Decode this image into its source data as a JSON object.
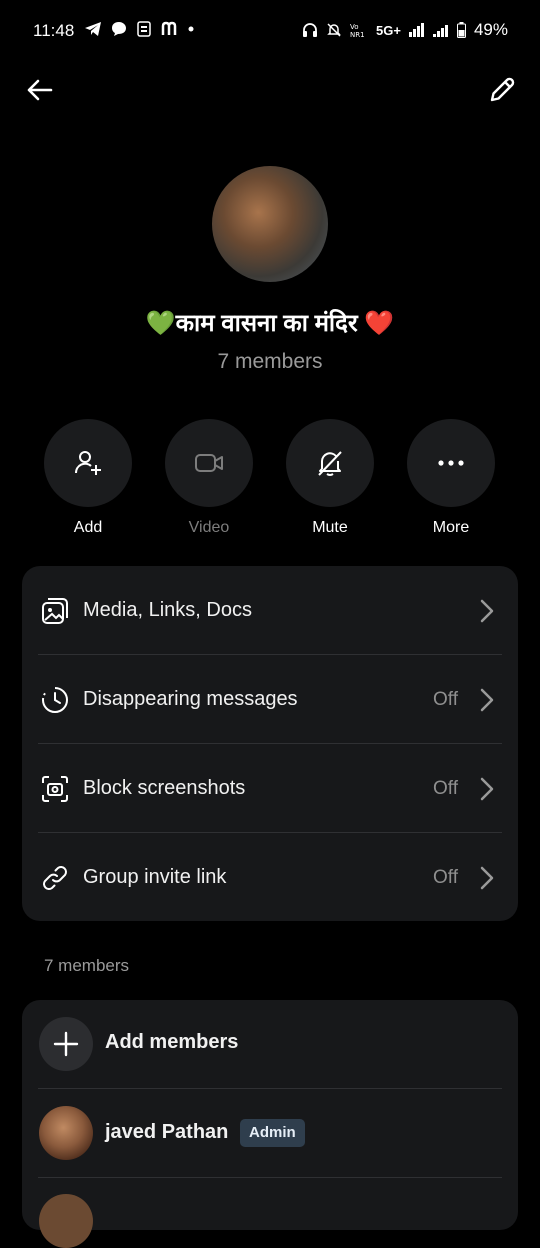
{
  "status_bar": {
    "time": "11:48",
    "network": "5G+",
    "battery": "49%"
  },
  "header": {
    "back_icon": "arrow-left-icon",
    "edit_icon": "pencil-icon"
  },
  "group": {
    "name": "💚काम वासना का मंदिर ❤️",
    "members_count_label": "7 members"
  },
  "actions": [
    {
      "label": "Add",
      "icon": "add-user-icon",
      "enabled": true
    },
    {
      "label": "Video",
      "icon": "video-icon",
      "enabled": false
    },
    {
      "label": "Mute",
      "icon": "bell-off-icon",
      "enabled": true
    },
    {
      "label": "More",
      "icon": "more-dots-icon",
      "enabled": true
    }
  ],
  "settings": [
    {
      "label": "Media, Links, Docs",
      "value": "",
      "icon": "media-icon"
    },
    {
      "label": "Disappearing messages",
      "value": "Off",
      "icon": "timer-icon"
    },
    {
      "label": "Block screenshots",
      "value": "Off",
      "icon": "screenshot-block-icon"
    },
    {
      "label": "Group invite link",
      "value": "Off",
      "icon": "link-icon"
    }
  ],
  "members": {
    "heading": "7 members",
    "add_label": "Add members",
    "list": [
      {
        "name": "javed Pathan",
        "badge": "Admin"
      }
    ]
  },
  "colors": {
    "background": "#000000",
    "card": "#17181a",
    "action_circle": "#1b1c1e",
    "muted_text": "#9a9a9a",
    "admin_badge": "#2f3e4d"
  }
}
